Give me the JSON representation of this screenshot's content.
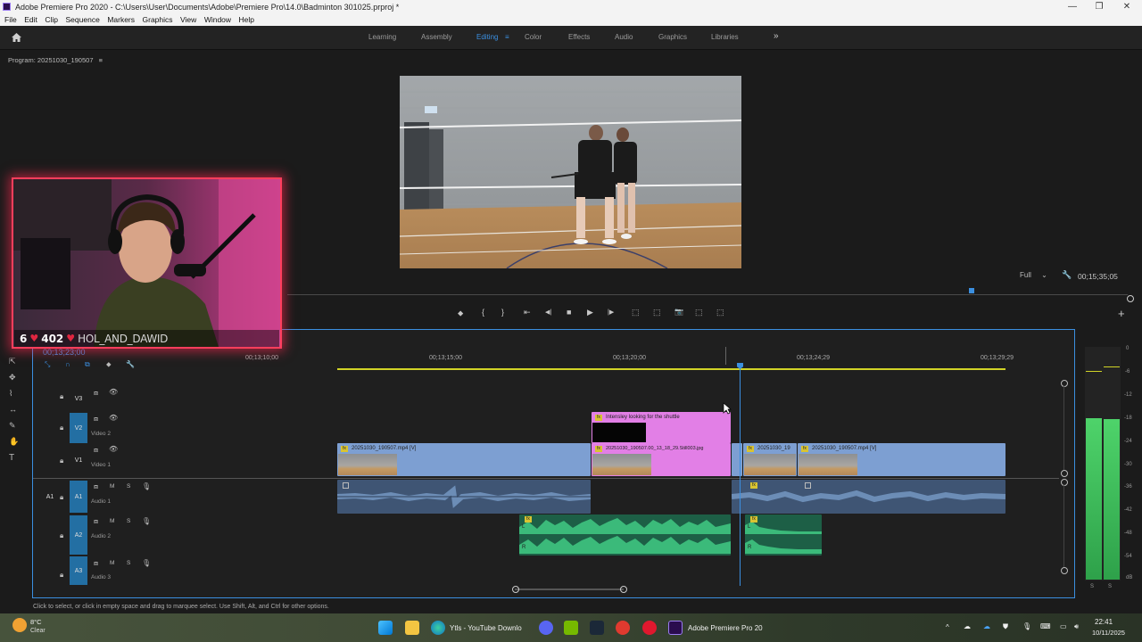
{
  "titlebar": {
    "title": "Adobe Premiere Pro 2020 - C:\\Users\\User\\Documents\\Adobe\\Premiere Pro\\14.0\\Badminton 301025.prproj *",
    "minimize": "—",
    "maximize": "❐",
    "close": "✕"
  },
  "menu": [
    "File",
    "Edit",
    "Clip",
    "Sequence",
    "Markers",
    "Graphics",
    "View",
    "Window",
    "Help"
  ],
  "workspaces": {
    "items": [
      "Learning",
      "Assembly",
      "Editing",
      "Color",
      "Effects",
      "Audio",
      "Graphics",
      "Libraries"
    ],
    "active": "Editing",
    "more": "»"
  },
  "program": {
    "label": "Program: 20251030_190507",
    "menu_icon": "≡",
    "resolution": "Full",
    "duration": "00;15;35;05"
  },
  "transport": {
    "add_marker": "⬥",
    "mark_in": "{",
    "mark_out": "}",
    "go_in": "⇤",
    "step_back": "◀|",
    "stop": "■",
    "play": "▶",
    "step_fwd": "|▶",
    "go_out": "⇥",
    "lift": "⬚",
    "extract": "⬚",
    "export_frame": "📷",
    "compare": "⬚",
    "multi": "⬚",
    "add": "+"
  },
  "webcam": {
    "stat_1": "6",
    "stat_2": "402",
    "handle": "HOL_AND_DAWID"
  },
  "timeline": {
    "timecode": "00;13;23;00",
    "ruler": [
      "00;13;10;00",
      "00;13;15;00",
      "00;13;20;00",
      "00;13;24;29",
      "00;13;29;29"
    ],
    "tracks": {
      "v3": {
        "id": "V3",
        "name": ""
      },
      "v2": {
        "id": "V2",
        "name": "Video 2"
      },
      "v1": {
        "id": "V1",
        "name": "Video 1"
      },
      "a1": {
        "src": "A1",
        "id": "A1",
        "name": "Audio 1"
      },
      "a2": {
        "id": "A2",
        "name": "Audio 2"
      },
      "a3": {
        "id": "A3",
        "name": "Audio 3"
      }
    },
    "track_buttons": {
      "mute": "M",
      "solo": "S"
    },
    "clips": {
      "title_clip": "Intensley looking for the shuttle",
      "v1_a": "20251030_190507.mp4 [V]",
      "v1_b": "20251030_190507.00_13_18_29.Still003.jpg",
      "v1_c": "20251030_19",
      "v1_d": "20251030_190507.mp4 [V]"
    },
    "audio_channels": {
      "left": "L",
      "right": "R"
    }
  },
  "meter": {
    "scale": [
      "0",
      "-6",
      "-12",
      "-18",
      "-24",
      "-30",
      "-36",
      "-42",
      "-48",
      "-54",
      "dB"
    ],
    "solo": [
      "S",
      "S"
    ],
    "level_left": 0.48,
    "level_right": 0.47
  },
  "status": "Click to select, or click in empty space and drag to marquee select. Use Shift, Alt, and Ctrl for other options.",
  "taskbar": {
    "weather_temp": "8°C",
    "weather_desc": "Clear",
    "app1": "Ytls - YouTube Downlo",
    "app2": "Adobe Premiere Pro 20",
    "time": "22:41",
    "date": "10/11/2025"
  },
  "colors": {
    "accent": "#3b8fe0",
    "video_clip": "#7d9fd2",
    "title_clip": "#e27fe6",
    "audio_clip": "#3bba7a",
    "webcam_border": "#ff3e5c"
  }
}
